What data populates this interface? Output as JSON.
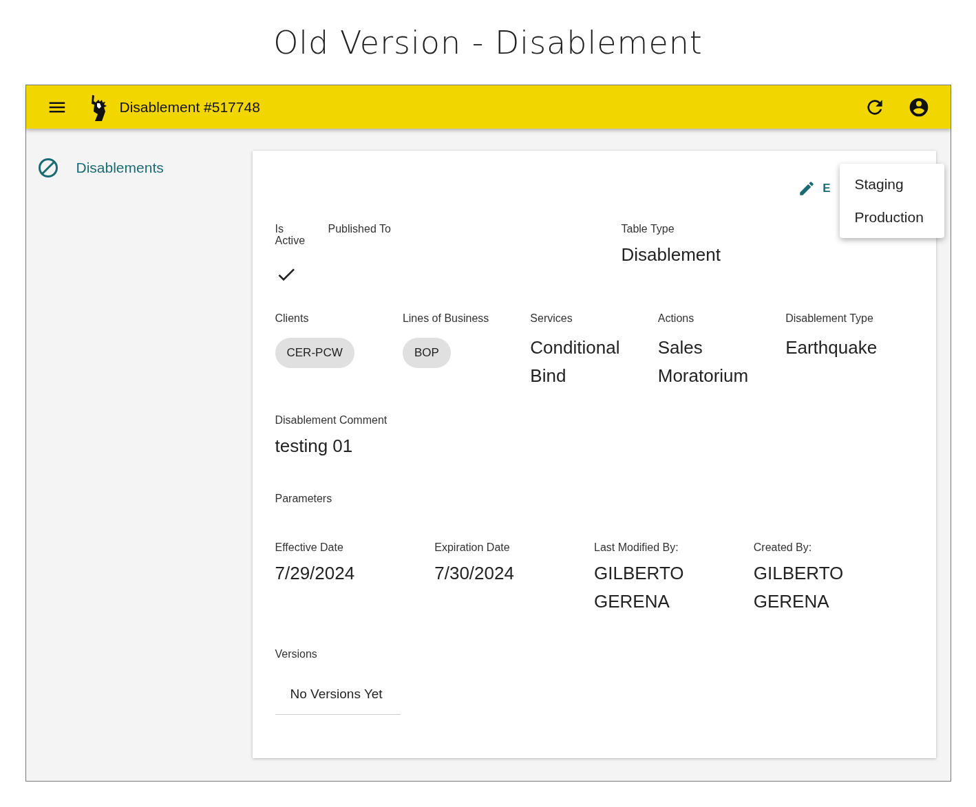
{
  "page_title": "Old Version - Disablement",
  "app_bar": {
    "title": "Disablement #517748"
  },
  "sidebar": {
    "items": [
      {
        "label": "Disablements",
        "selected": true
      }
    ]
  },
  "edit_button": {
    "label": "E"
  },
  "publish_menu": {
    "items": [
      "Staging",
      "Production"
    ]
  },
  "summary_row": [
    {
      "kind": "check",
      "label": "Is Active",
      "checked": true
    },
    {
      "kind": "empty",
      "label": "Published To"
    },
    {
      "kind": "text",
      "label": "Table Type",
      "value": "Disablement"
    }
  ],
  "detail_row": [
    {
      "kind": "chips",
      "label": "Clients",
      "chips": [
        "CER-PCW"
      ]
    },
    {
      "kind": "chips",
      "label": "Lines of Business",
      "chips": [
        "BOP"
      ]
    },
    {
      "kind": "text",
      "label": "Services",
      "value": "Conditional Bind"
    },
    {
      "kind": "text",
      "label": "Actions",
      "value": "Sales Moratorium"
    },
    {
      "kind": "text",
      "label": "Disablement Type",
      "value": "Earthquake"
    }
  ],
  "comment": {
    "label": "Disablement Comment",
    "value": "testing 01"
  },
  "parameters": {
    "label": "Parameters"
  },
  "dates_row": [
    {
      "label": "Effective Date",
      "value": "7/29/2024"
    },
    {
      "label": "Expiration Date",
      "value": "7/30/2024"
    },
    {
      "label": "Last Modified By:",
      "value": "GILBERTO GERENA"
    },
    {
      "label": "Created By:",
      "value": "GILBERTO GERENA"
    }
  ],
  "versions": {
    "label": "Versions",
    "empty_text": "No Versions Yet"
  }
}
